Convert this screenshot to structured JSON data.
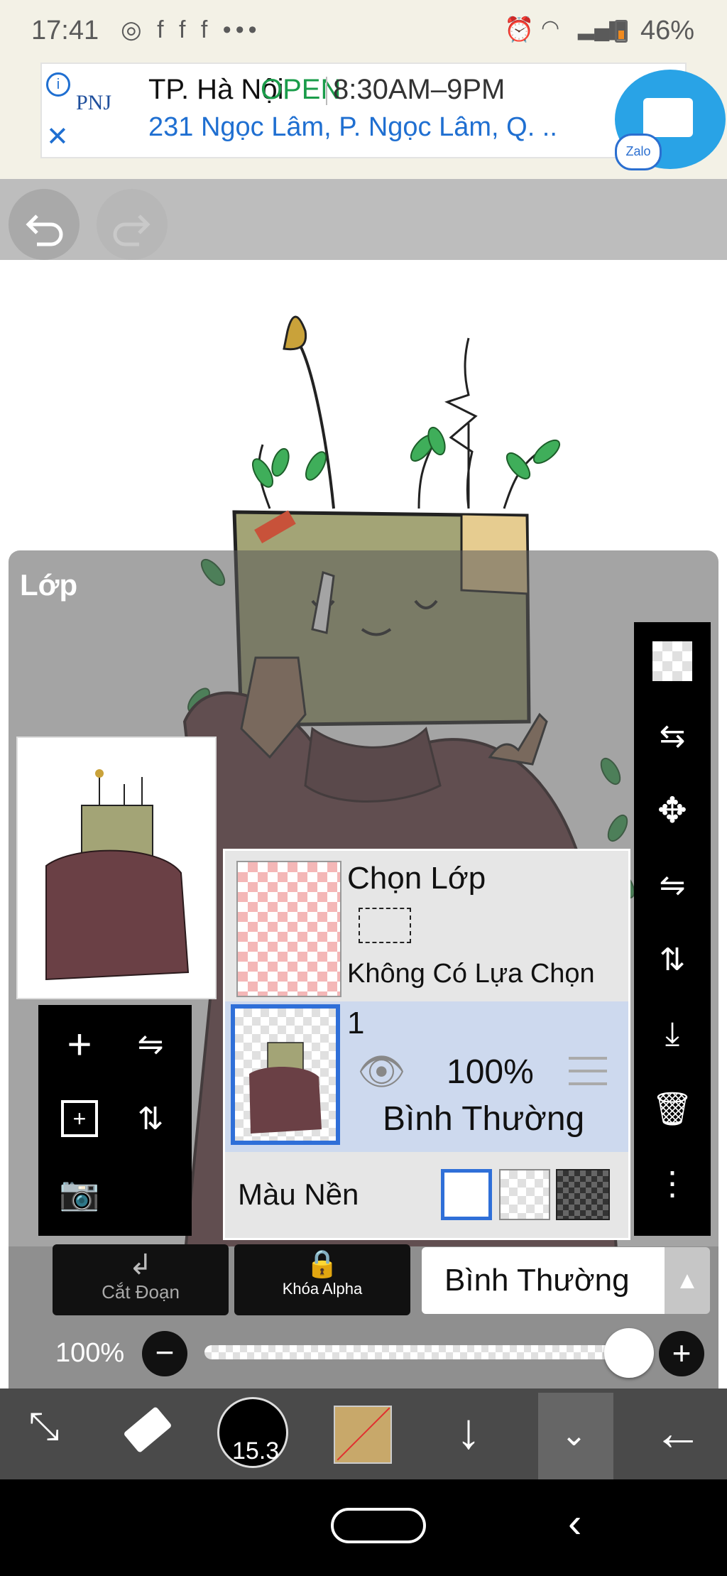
{
  "status_bar": {
    "time": "17:41",
    "notif_icons": "◎ f f f •••",
    "battery": "46%"
  },
  "ad": {
    "brand": "PNJ",
    "city": "TP. Hà Nội",
    "status": "OPEN",
    "hours": "8:30AM–9PM",
    "address": "231 Ngọc Lâm, P. Ngọc Lâm, Q. ..",
    "app_badge": "Zalo"
  },
  "layer_panel": {
    "title": "Lớp",
    "selection_layer": {
      "title": "Chọn Lớp",
      "subtitle": "Không Có Lựa Chọn"
    },
    "layer": {
      "name": "1",
      "opacity": "100%",
      "blend": "Bình Thường"
    },
    "background_label": "Màu Nền"
  },
  "controls": {
    "clip_label": "Cắt Đoạn",
    "alpha_lock_label": "Khóa Alpha",
    "blend_mode": "Bình Thường",
    "opacity_label": "100%",
    "opacity_value": 1.0
  },
  "bottom_toolbar": {
    "brush_size": "15.3"
  },
  "colors": {
    "panel_bg": "#5a5a5a",
    "selected_layer": "#cdd9ee",
    "accent_blue": "#2f6fd8",
    "current_color": "#c8a86a",
    "open_green": "#1a9c4a",
    "link_blue": "#1f6fd1"
  }
}
